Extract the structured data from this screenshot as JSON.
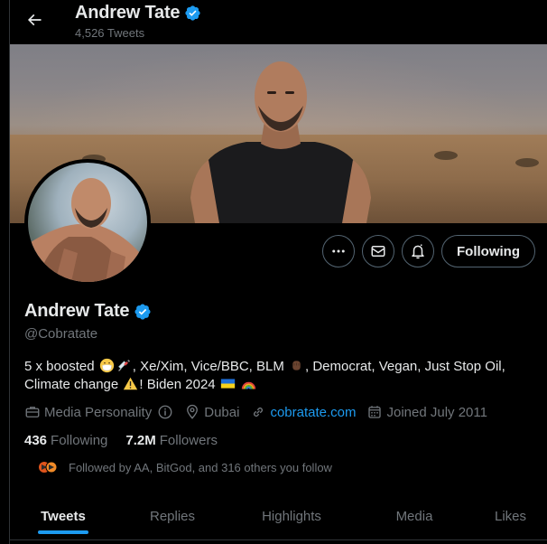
{
  "header": {
    "name": "Andrew Tate",
    "tweet_count": "4,526 Tweets",
    "icons": [
      "back-arrow-icon",
      "verified-badge-icon"
    ]
  },
  "actions": {
    "more_icon": "more-icon",
    "message_icon": "mail-icon",
    "notify_icon": "bell-icon",
    "following_label": "Following"
  },
  "profile": {
    "name": "Andrew Tate",
    "handle": "@Cobratate",
    "bio": {
      "part1": "5 x boosted ",
      "part2": ", Xe/Xim, Vice/BBC, BLM ",
      "part3": ", Democrat, Vegan, Just Stop Oil,",
      "part4": "Climate change ",
      "part5": "! Biden 2024 ",
      "emojis": [
        "face-with-mask-emoji",
        "syringe-emoji",
        "raised-fist-emoji",
        "warning-emoji",
        "ukraine-flag-emoji",
        "rainbow-emoji"
      ]
    },
    "meta": {
      "category": "Media Personality",
      "location": "Dubai",
      "website": "cobratate.com",
      "joined": "Joined July 2011"
    },
    "stats": {
      "following_count": "436",
      "following_label": "Following",
      "followers_count": "7.2M",
      "followers_label": "Followers"
    },
    "followed_by": "Followed by AA, BitGod, and 316 others you follow"
  },
  "tabs": [
    {
      "label": "Tweets",
      "active": true
    },
    {
      "label": "Replies",
      "active": false
    },
    {
      "label": "Highlights",
      "active": false
    },
    {
      "label": "Media",
      "active": false
    },
    {
      "label": "Likes",
      "active": false
    }
  ],
  "colors": {
    "accent": "#1d9bf0",
    "text": "#e7e9ea",
    "muted": "#71767b",
    "border": "#536471",
    "background": "#000000"
  }
}
